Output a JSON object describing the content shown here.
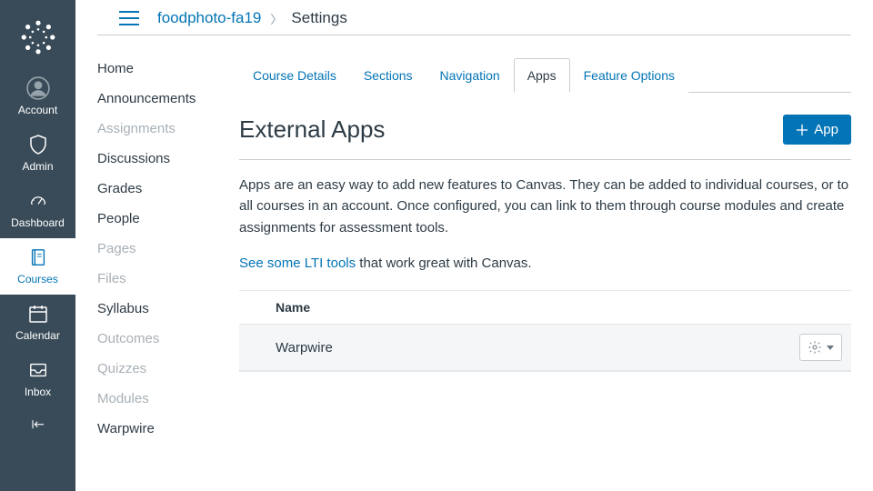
{
  "colors": {
    "link": "#0374b5",
    "nav_bg": "#394b58"
  },
  "global_nav": {
    "items": [
      {
        "label": "Account",
        "icon": "avatar-icon"
      },
      {
        "label": "Admin",
        "icon": "shield-icon"
      },
      {
        "label": "Dashboard",
        "icon": "speedometer-icon"
      },
      {
        "label": "Courses",
        "icon": "book-icon",
        "active": true
      },
      {
        "label": "Calendar",
        "icon": "calendar-icon"
      },
      {
        "label": "Inbox",
        "icon": "inbox-icon"
      }
    ]
  },
  "breadcrumb": {
    "course": "foodphoto-fa19",
    "current": "Settings"
  },
  "course_nav": [
    {
      "label": "Home",
      "disabled": false
    },
    {
      "label": "Announcements",
      "disabled": false
    },
    {
      "label": "Assignments",
      "disabled": true
    },
    {
      "label": "Discussions",
      "disabled": false
    },
    {
      "label": "Grades",
      "disabled": false
    },
    {
      "label": "People",
      "disabled": false
    },
    {
      "label": "Pages",
      "disabled": true
    },
    {
      "label": "Files",
      "disabled": true
    },
    {
      "label": "Syllabus",
      "disabled": false
    },
    {
      "label": "Outcomes",
      "disabled": true
    },
    {
      "label": "Quizzes",
      "disabled": true
    },
    {
      "label": "Modules",
      "disabled": true
    },
    {
      "label": "Warpwire",
      "disabled": false
    }
  ],
  "tabs": [
    {
      "label": "Course Details"
    },
    {
      "label": "Sections"
    },
    {
      "label": "Navigation"
    },
    {
      "label": "Apps",
      "active": true
    },
    {
      "label": "Feature Options"
    }
  ],
  "section": {
    "title": "External Apps",
    "add_button": "App",
    "description": "Apps are an easy way to add new features to Canvas. They can be added to individual courses, or to all courses in an account. Once configured, you can link to them through course modules and create assignments for assessment tools.",
    "lti_link": "See some LTI tools",
    "lti_suffix": " that work great with Canvas."
  },
  "table": {
    "column": "Name",
    "rows": [
      {
        "name": "Warpwire"
      }
    ]
  }
}
